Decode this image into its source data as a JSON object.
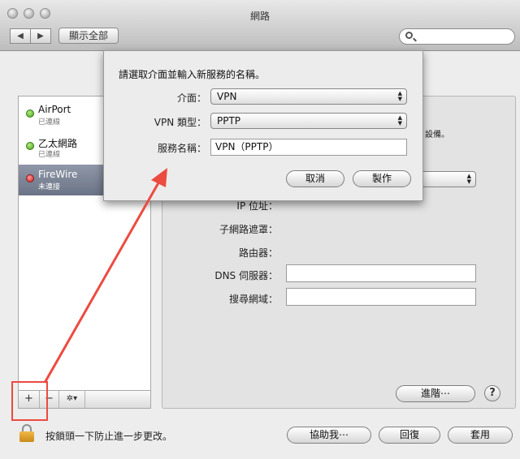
{
  "window": {
    "title": "網路"
  },
  "toolbar": {
    "show_all_label": "顯示全部",
    "back_symbol": "◀",
    "forward_symbol": "▶"
  },
  "search": {
    "placeholder": ""
  },
  "services": [
    {
      "name": "AirPort",
      "status": "已連線",
      "state": "connected"
    },
    {
      "name": "乙太網路",
      "status": "已連線",
      "state": "connected"
    },
    {
      "name": "FireWire",
      "status": "未連接",
      "state": "disconnected"
    }
  ],
  "sidebar_toolbar": {
    "add": "+",
    "remove": "−",
    "gear": "✲▾"
  },
  "background_panel": {
    "partial_text": "設備。",
    "labels": {
      "ip": "IP 位址：",
      "subnet": "子網路遮罩：",
      "router": "路由器：",
      "dns": "DNS 伺服器：",
      "search_domains": "搜尋網域："
    },
    "advanced_button": "進階⋯",
    "help_label": "?"
  },
  "bottom": {
    "lock_text": "按鎖頭一下防止進一步更改。",
    "assist_button": "協助我⋯",
    "revert_button": "回復",
    "apply_button": "套用"
  },
  "sheet": {
    "prompt": "請選取介面並輸入新服務的名稱。",
    "interface_label": "介面：",
    "interface_value": "VPN",
    "vpn_type_label": "VPN 類型：",
    "vpn_type_value": "PPTP",
    "service_name_label": "服務名稱：",
    "service_name_value": "VPN（PPTP）",
    "cancel_button": "取消",
    "create_button": "製作"
  },
  "colors": {
    "annotation": "#ec4b40",
    "selection": "#7a8396"
  }
}
